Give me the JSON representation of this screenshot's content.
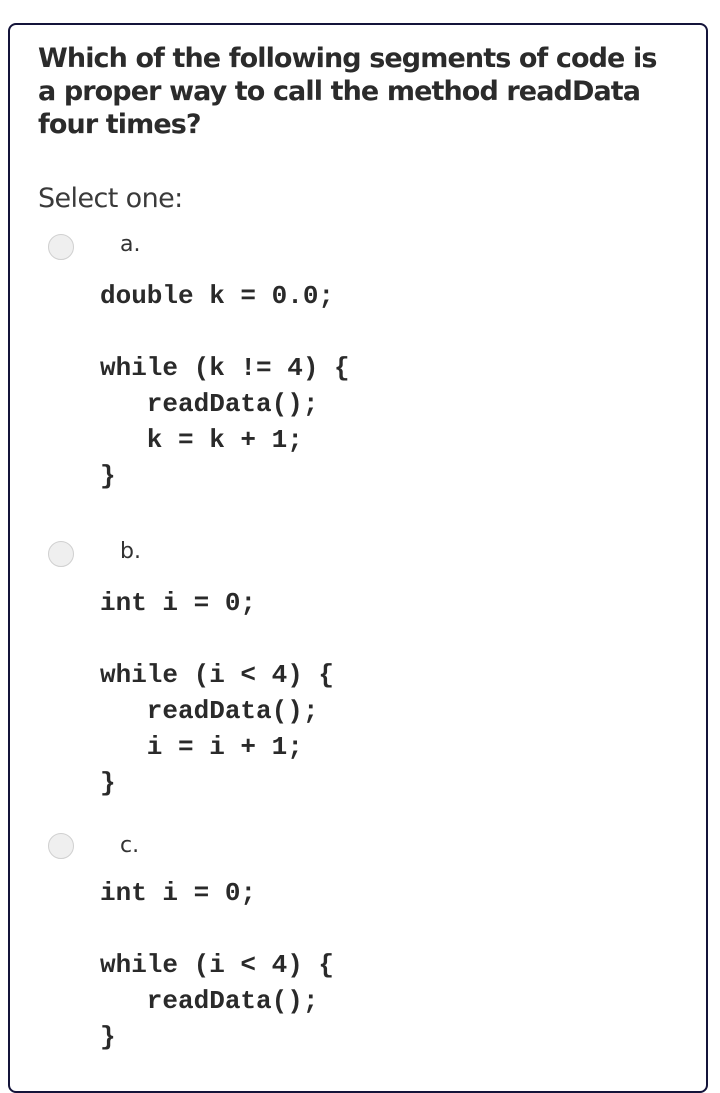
{
  "question": {
    "text": "Which of the following segments of code is a proper way to call the method readData four times?",
    "prompt": "Select one:"
  },
  "options": [
    {
      "label": "a.",
      "selected": false,
      "code_lines": [
        "double k = 0.0;",
        "",
        "while (k != 4) {",
        "   readData();",
        "   k = k + 1;",
        "}"
      ]
    },
    {
      "label": "b.",
      "selected": false,
      "code_lines": [
        "int i = 0;",
        "",
        "while (i < 4) {",
        "   readData();",
        "   i = i + 1;",
        "}"
      ]
    },
    {
      "label": "c.",
      "selected": false,
      "code_lines": [
        "int i = 0;",
        "",
        "while (i < 4) {",
        "   readData();",
        "}"
      ]
    }
  ],
  "colors": {
    "card_border": "#14143a",
    "text": "#2b2b2b",
    "radio_fill": "#efefef"
  }
}
